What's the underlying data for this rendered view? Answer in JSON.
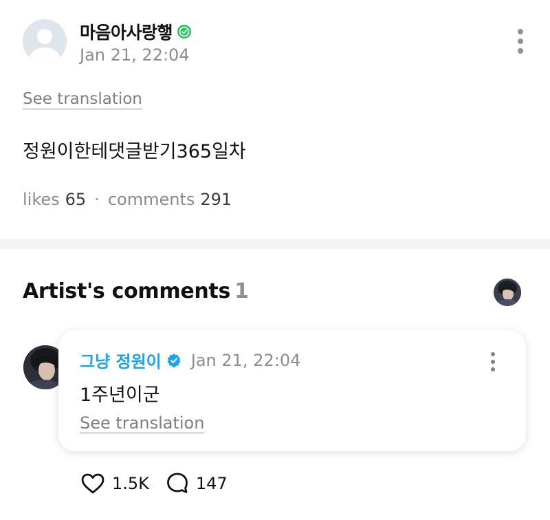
{
  "post": {
    "author": "마음아사랑햏",
    "time": "Jan 21, 22:04",
    "see_translation": "See translation",
    "body": "정원이한테댓글받기365일차",
    "likes_label": "likes",
    "likes_count": "65",
    "separator": "·",
    "comments_label": "comments",
    "comments_count": "291",
    "badge_color": "#22c55e"
  },
  "artist_comments": {
    "title": "Artist's comments",
    "count": "1"
  },
  "comment": {
    "author": "그냥 정원이",
    "time": "Jan 21, 22:04",
    "text": "1주년이군",
    "see_translation": "See translation",
    "like_count": "1.5K",
    "reply_count": "147",
    "author_color": "#1aa3f0",
    "badge_color": "#1aa3f0"
  },
  "icons": [
    "default-avatar-icon",
    "green-check-badge-icon",
    "more-vertical-icon",
    "verified-badge-icon",
    "heart-icon",
    "comment-bubble-icon"
  ]
}
